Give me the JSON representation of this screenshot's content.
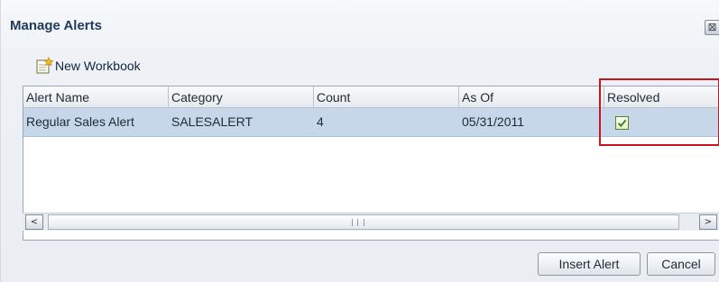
{
  "dialog": {
    "title": "Manage Alerts",
    "close_glyph": "⊠"
  },
  "toolbar": {
    "new_workbook_label": "New Workbook",
    "new_workbook_icon": "new-workbook-icon"
  },
  "table": {
    "columns": [
      "Alert Name",
      "Category",
      "Count",
      "As Of",
      "Resolved"
    ],
    "rows": [
      {
        "alert_name": "Regular Sales Alert",
        "category": "SALESALERT",
        "count": "4",
        "as_of": "05/31/2011",
        "resolved": true
      }
    ]
  },
  "scrollbar": {
    "left_arrow": "<",
    "right_arrow": ">"
  },
  "buttons": {
    "insert_alert": "Insert Alert",
    "cancel": "Cancel"
  },
  "colors": {
    "selected_row": "#c6d7ea",
    "highlight_box": "#c8141e",
    "title_text": "#1f3a5a"
  }
}
